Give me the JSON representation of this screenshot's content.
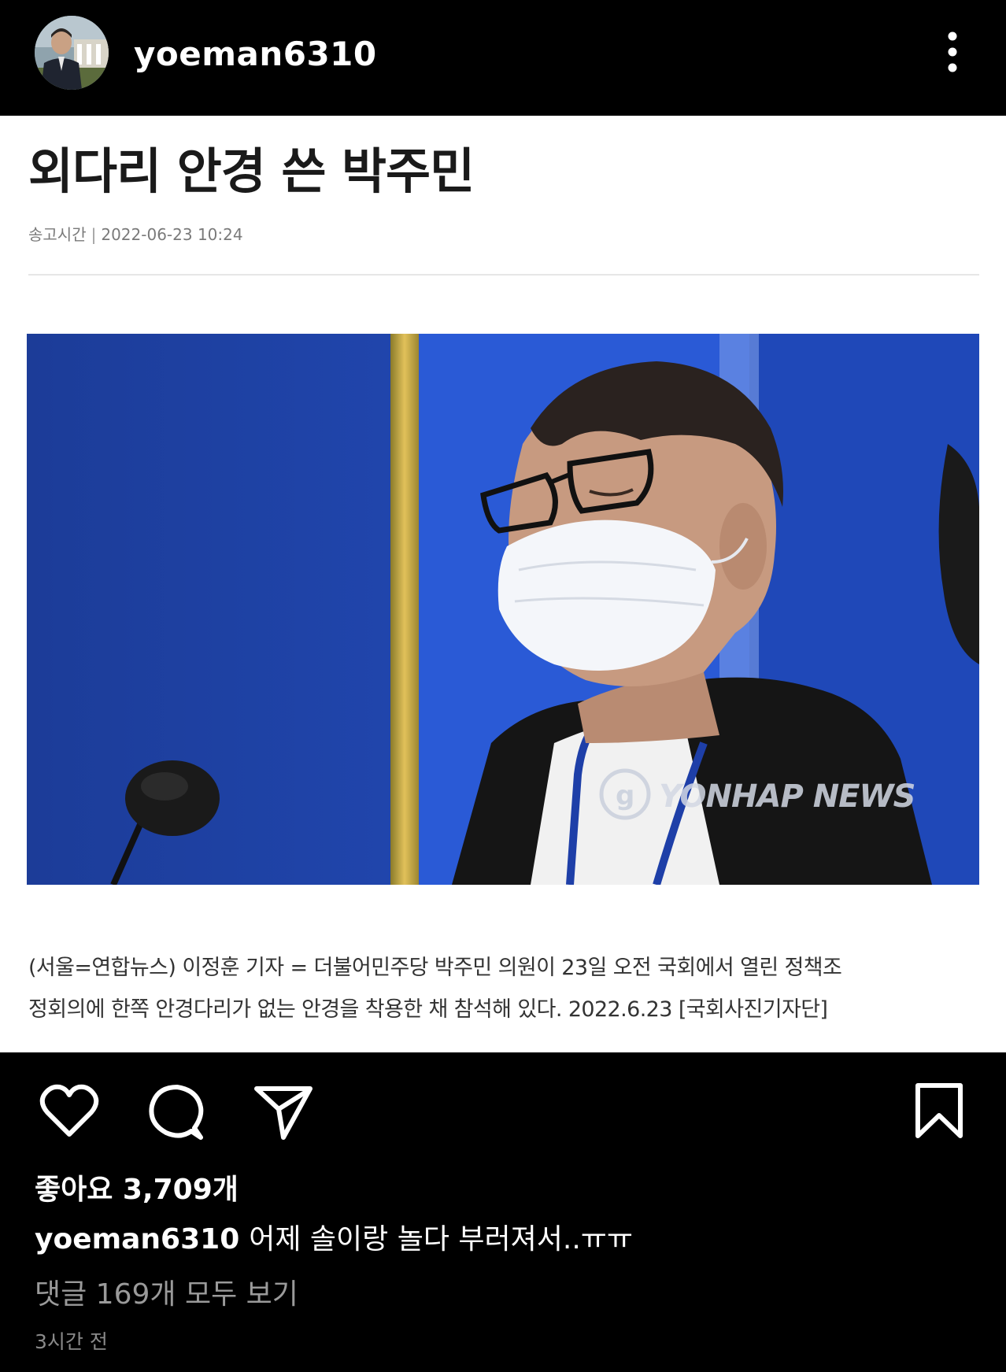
{
  "header": {
    "username": "yoeman6310",
    "more_icon": "more-vertical-icon"
  },
  "article": {
    "headline": "외다리 안경 쓴 박주민",
    "meta_label": "송고시간",
    "meta_separator": "|",
    "meta_datetime": "2022-06-23 10:24",
    "photo_watermark": "YONHAP NEWS",
    "caption_line1": "(서울=연합뉴스) 이정훈 기자 = 더불어민주당 박주민 의원이 23일 오전 국회에서 열린 정책조",
    "caption_line2": "정회의에 한쪽 안경다리가 없는 안경을 착용한 채 참석해 있다. 2022.6.23 [국회사진기자단]"
  },
  "actions": {
    "like_icon": "heart-icon",
    "comment_icon": "comment-icon",
    "share_icon": "send-icon",
    "save_icon": "bookmark-icon"
  },
  "post": {
    "likes": "좋아요 3,709개",
    "caption_user": "yoeman6310",
    "caption_text": "어제 솔이랑 놀다 부러져서..ㅠㅠ",
    "comments_link": "댓글 169개 모두 보기",
    "time_ago": "3시간 전"
  },
  "colors": {
    "bar_background": "#000000",
    "photo_blue": "#1b3f9e",
    "muted_text": "#9a9a9a"
  }
}
